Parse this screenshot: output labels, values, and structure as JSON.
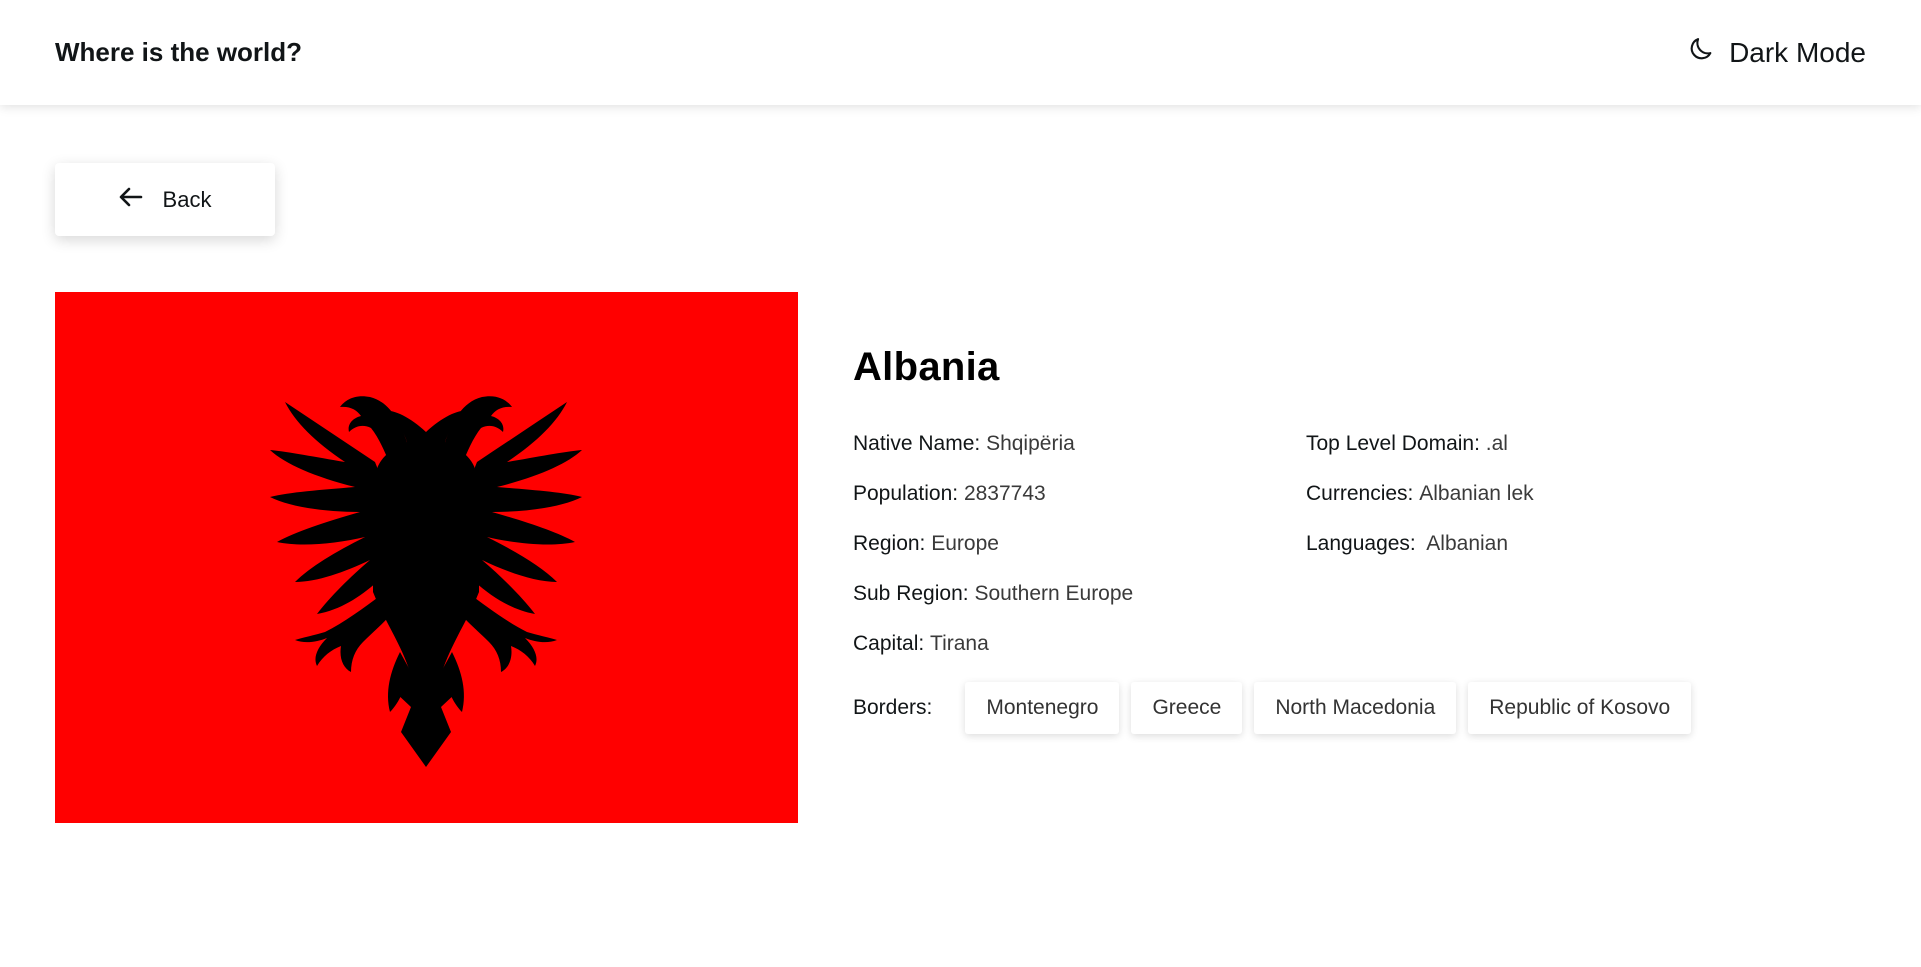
{
  "header": {
    "title": "Where is the world?",
    "theme_toggle_label": "Dark Mode",
    "theme_icon": "moon-icon"
  },
  "back_button": {
    "label": "Back",
    "icon": "arrow-left-icon"
  },
  "flag": {
    "background_color": "#ff0000",
    "emblem_color": "#000000",
    "emblem": "double-headed-eagle"
  },
  "country": {
    "name": "Albania",
    "left_info": [
      {
        "label": "Native Name:",
        "value": "Shqipëria"
      },
      {
        "label": "Population:",
        "value": "2837743"
      },
      {
        "label": "Region:",
        "value": "Europe"
      },
      {
        "label": "Sub Region:",
        "value": "Southern Europe"
      },
      {
        "label": "Capital:",
        "value": "Tirana"
      }
    ],
    "right_info": [
      {
        "label": "Top Level Domain:",
        "value": ".al"
      },
      {
        "label": "Currencies:",
        "value": "Albanian lek"
      },
      {
        "label": "Languages:",
        "value": " Albanian"
      }
    ],
    "borders_label": "Borders:",
    "borders": [
      "Montenegro",
      "Greece",
      "North Macedonia",
      "Republic of Kosovo"
    ]
  }
}
